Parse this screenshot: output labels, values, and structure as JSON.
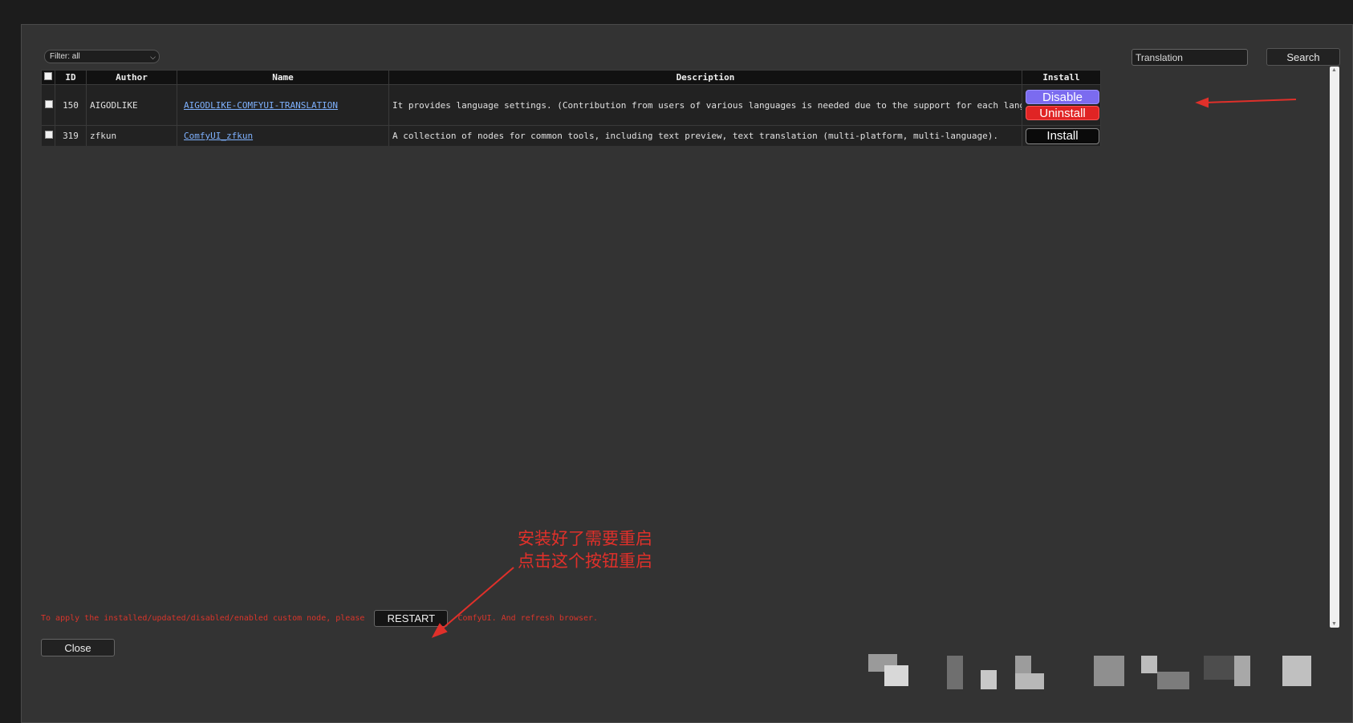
{
  "filter": {
    "value": "Filter: all"
  },
  "search": {
    "value": "Translation",
    "button_label": "Search"
  },
  "table": {
    "headers": {
      "id": "ID",
      "author": "Author",
      "name": "Name",
      "description": "Description",
      "install": "Install"
    },
    "rows": [
      {
        "id": "150",
        "author": "AIGODLIKE",
        "name": "AIGODLIKE-COMFYUI-TRANSLATION",
        "description": "It provides language settings. (Contribution from users of various languages is needed due to the support for each language.)",
        "actions": [
          "Disable",
          "Uninstall"
        ]
      },
      {
        "id": "319",
        "author": "zfkun",
        "name": "ComfyUI_zfkun",
        "description": "A collection of nodes for common tools, including text preview, text translation (multi-platform, multi-language).",
        "actions": [
          "Install"
        ]
      }
    ]
  },
  "footer": {
    "restart_prefix": "To apply the installed/updated/disabled/enabled custom node, please",
    "restart_label": "RESTART",
    "restart_suffix": "ComfyUI. And refresh browser.",
    "close_label": "Close"
  },
  "annotation": {
    "line1": "安装好了需要重启",
    "line2": "点击这个按钮重启",
    "color": "#e0302a"
  },
  "colors": {
    "disable": "#7b6bf0",
    "uninstall": "#e02424",
    "link": "#7fb2ff",
    "warning_text": "#d9352b"
  }
}
